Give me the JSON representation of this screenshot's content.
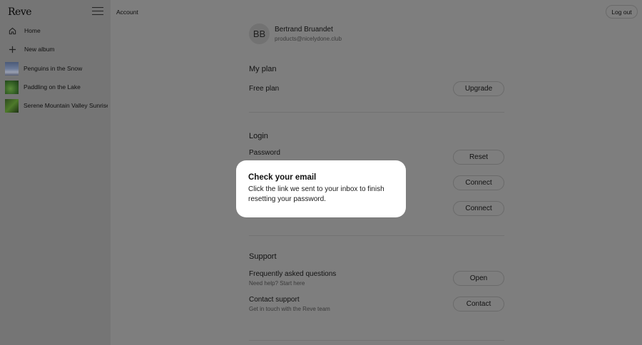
{
  "app": {
    "logo": "Reve"
  },
  "sidebar": {
    "items": [
      {
        "label": "Home",
        "icon": "home-icon"
      },
      {
        "label": "New album",
        "icon": "plus-icon"
      },
      {
        "label": "Penguins in the Snow",
        "thumb": "snow"
      },
      {
        "label": "Paddling on the Lake",
        "thumb": "lake"
      },
      {
        "label": "Serene Mountain Valley Sunrise",
        "thumb": "valley"
      }
    ]
  },
  "header": {
    "title": "Account",
    "logout_label": "Log out"
  },
  "user": {
    "initials": "BB",
    "name": "Bertrand Bruandet",
    "email": "products@nicelydone.club"
  },
  "plan": {
    "section_title": "My plan",
    "plan_name": "Free plan",
    "upgrade_label": "Upgrade"
  },
  "login": {
    "section_title": "Login",
    "password_label": "Password",
    "reset_label": "Reset",
    "connect_label_1": "Connect",
    "connect_label_2": "Connect"
  },
  "support": {
    "section_title": "Support",
    "faq_title": "Frequently asked questions",
    "faq_sub": "Need help? Start here",
    "faq_button": "Open",
    "contact_title": "Contact support",
    "contact_sub": "Get in touch with the Reve team",
    "contact_button": "Contact"
  },
  "modal": {
    "title": "Check your email",
    "message": "Click the link we sent to your inbox to finish resetting your password."
  },
  "colors": {
    "overlay_bg": "#7e7e7e",
    "sidebar_bg": "#757575",
    "modal_bg": "#ffffff"
  }
}
